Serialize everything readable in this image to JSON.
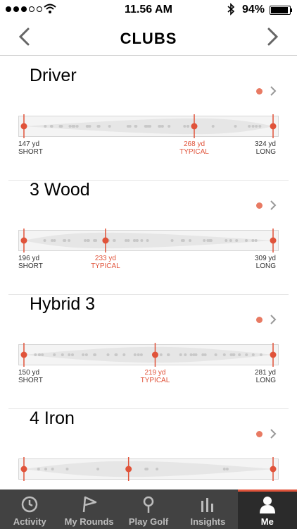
{
  "status_bar": {
    "time": "11.56 AM",
    "battery_pct": "94%",
    "battery_level": 0.94,
    "signal_bars": 3
  },
  "nav": {
    "title": "CLUBS"
  },
  "clubs": [
    {
      "name": "Driver",
      "short": "147 yd",
      "short_label": "SHORT",
      "typical": "268 yd",
      "typical_label": "TYPICAL",
      "long": "324 yd",
      "long_label": "LONG",
      "short_val": 147,
      "typ_val": 268,
      "long_val": 324
    },
    {
      "name": "3 Wood",
      "short": "196 yd",
      "short_label": "SHORT",
      "typical": "233 yd",
      "typical_label": "TYPICAL",
      "long": "309 yd",
      "long_label": "LONG",
      "short_val": 196,
      "typ_val": 233,
      "long_val": 309
    },
    {
      "name": "Hybrid 3",
      "short": "150 yd",
      "short_label": "SHORT",
      "typical": "219 yd",
      "typical_label": "TYPICAL",
      "long": "281 yd",
      "long_label": "LONG",
      "short_val": 150,
      "typ_val": 219,
      "long_val": 281
    },
    {
      "name": "4 Iron"
    }
  ],
  "tabs": [
    {
      "label": "Activity",
      "icon": "clock-icon"
    },
    {
      "label": "My Rounds",
      "icon": "flag-icon"
    },
    {
      "label": "Play Golf",
      "icon": "location-pin-icon"
    },
    {
      "label": "Insights",
      "icon": "bar-chart-icon"
    },
    {
      "label": "Me",
      "icon": "person-icon",
      "active": true
    }
  ],
  "colors": {
    "accent": "#e0533a",
    "status_dot": "#e87a63",
    "tab_bg": "#424242",
    "tab_active_bg": "#2b2b2b"
  }
}
